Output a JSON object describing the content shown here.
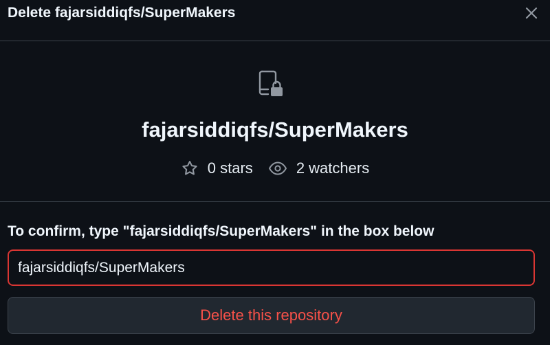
{
  "dialog": {
    "title": "Delete fajarsiddiqfs/SuperMakers",
    "close_icon": "close-icon"
  },
  "repo": {
    "icon": "repo-locked-icon",
    "name": "fajarsiddiqfs/SuperMakers",
    "stars_label": "0 stars",
    "watchers_label": "2 watchers",
    "star_icon": "star-icon",
    "eye_icon": "eye-icon"
  },
  "confirm": {
    "label": "To confirm, type \"fajarsiddiqfs/SuperMakers\" in the box below",
    "input_value": "fajarsiddiqfs/SuperMakers",
    "button_label": "Delete this repository"
  },
  "colors": {
    "background": "#0d1117",
    "danger": "#f85149",
    "input_border_error": "#da3633",
    "button_bg": "#212830",
    "divider": "#3d444d"
  }
}
